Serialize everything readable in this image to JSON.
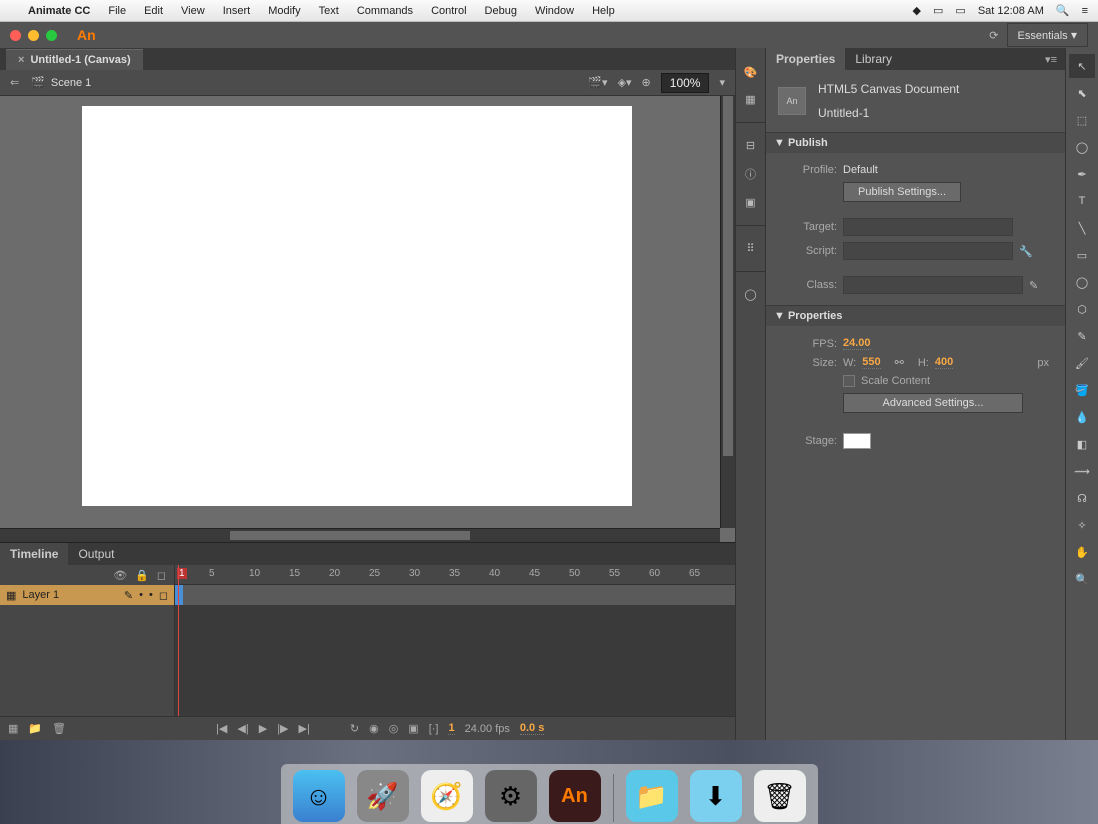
{
  "menubar": {
    "app": "Animate CC",
    "items": [
      "File",
      "Edit",
      "View",
      "Insert",
      "Modify",
      "Text",
      "Commands",
      "Control",
      "Debug",
      "Window",
      "Help"
    ],
    "datetime": "Sat 12:08 AM"
  },
  "titlebar": {
    "workspace": "Essentials"
  },
  "doctab": "Untitled-1 (Canvas)",
  "scene": "Scene 1",
  "zoom": "100%",
  "panels": {
    "tabs": [
      "Properties",
      "Library"
    ],
    "doctype": "HTML5 Canvas Document",
    "docname": "Untitled-1"
  },
  "publish": {
    "header": "Publish",
    "profile_lbl": "Profile:",
    "profile_val": "Default",
    "settings_btn": "Publish Settings...",
    "target_lbl": "Target:",
    "script_lbl": "Script:",
    "class_lbl": "Class:"
  },
  "props": {
    "header": "Properties",
    "fps_lbl": "FPS:",
    "fps": "24.00",
    "size_lbl": "Size:",
    "w_lbl": "W:",
    "w": "550",
    "h_lbl": "H:",
    "h": "400",
    "unit": "px",
    "scale": "Scale Content",
    "adv_btn": "Advanced Settings...",
    "stage_lbl": "Stage:"
  },
  "timeline": {
    "tabs": [
      "Timeline",
      "Output"
    ],
    "layer": "Layer 1",
    "marks": [
      "1",
      "5",
      "10",
      "15",
      "20",
      "25",
      "30",
      "35",
      "40",
      "45",
      "50",
      "55",
      "60",
      "65"
    ],
    "fps": "24.00 fps",
    "time": "0.0 s",
    "frame": "1"
  }
}
